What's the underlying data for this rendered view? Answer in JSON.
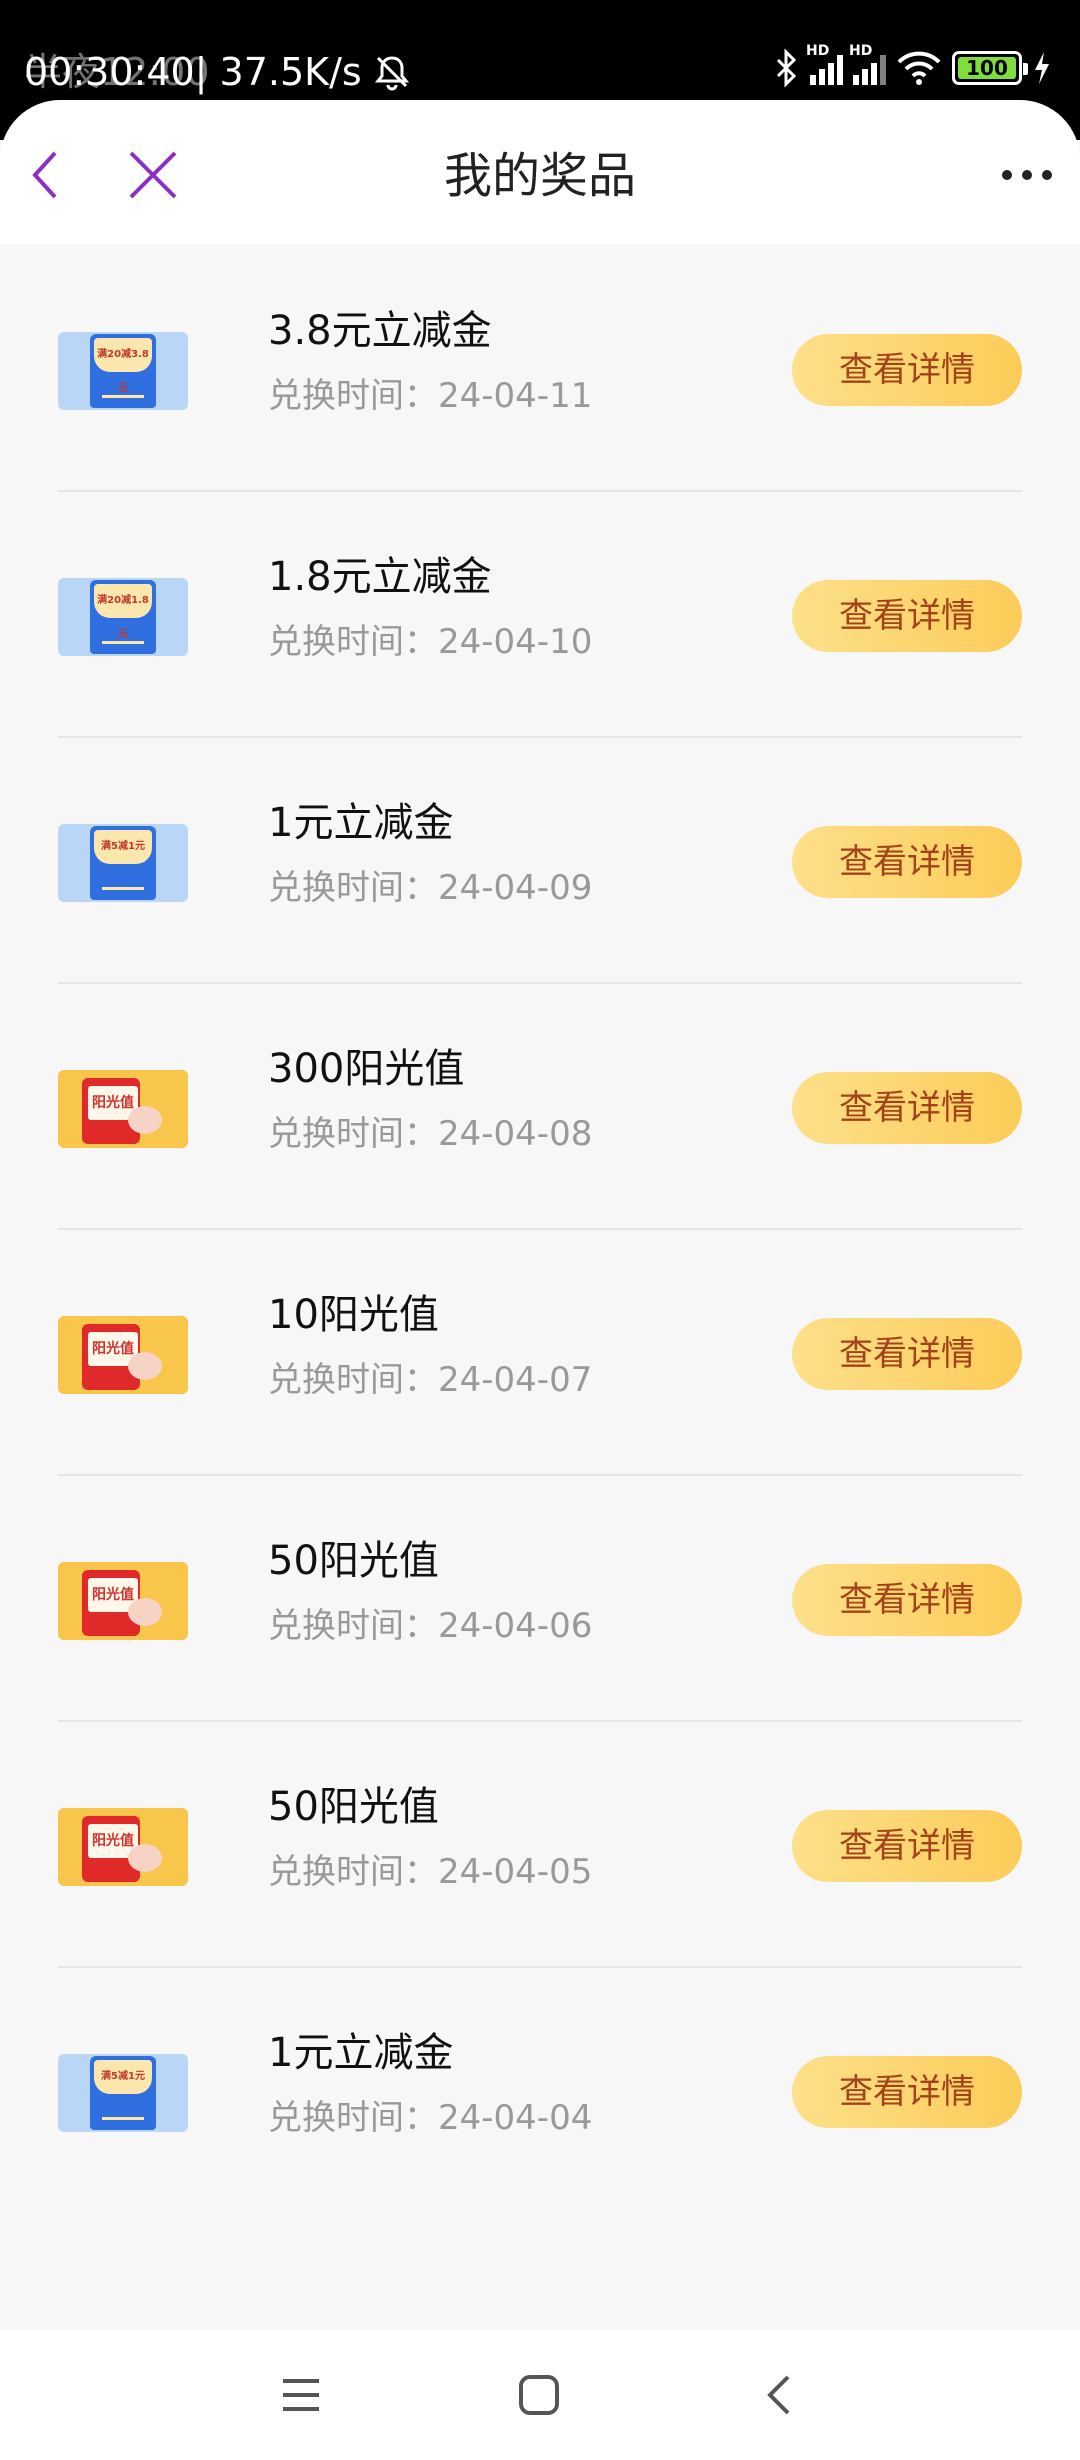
{
  "status_bar": {
    "time": "00:30:40",
    "network_speed": "| 37.5K/s",
    "ghost_text": "半夜12:00",
    "battery": "100",
    "hd1": "HD",
    "hd2": "HD"
  },
  "header": {
    "title": "我的奖品"
  },
  "prizes": [
    {
      "name": "3.8元立减金",
      "time": "兑换时间：24-04-11",
      "button": "查看详情",
      "thumb": "coupon",
      "thumb_text": "满20减3.8元"
    },
    {
      "name": "1.8元立减金",
      "time": "兑换时间：24-04-10",
      "button": "查看详情",
      "thumb": "coupon",
      "thumb_text": "满20减1.8元"
    },
    {
      "name": "1元立减金",
      "time": "兑换时间：24-04-09",
      "button": "查看详情",
      "thumb": "coupon",
      "thumb_text": "满5减1元"
    },
    {
      "name": "300阳光值",
      "time": "兑换时间：24-04-08",
      "button": "查看详情",
      "thumb": "redpack",
      "thumb_text": "阳光值"
    },
    {
      "name": "10阳光值",
      "time": "兑换时间：24-04-07",
      "button": "查看详情",
      "thumb": "redpack",
      "thumb_text": "阳光值"
    },
    {
      "name": "50阳光值",
      "time": "兑换时间：24-04-06",
      "button": "查看详情",
      "thumb": "redpack",
      "thumb_text": "阳光值"
    },
    {
      "name": "50阳光值",
      "time": "兑换时间：24-04-05",
      "button": "查看详情",
      "thumb": "redpack",
      "thumb_text": "阳光值"
    },
    {
      "name": "1元立减金",
      "time": "兑换时间：24-04-04",
      "button": "查看详情",
      "thumb": "coupon",
      "thumb_text": "满5减1元"
    }
  ],
  "colors": {
    "accent": "#8e2fc4",
    "button_text": "#a4421a",
    "button_bg": "#fbd26a"
  }
}
